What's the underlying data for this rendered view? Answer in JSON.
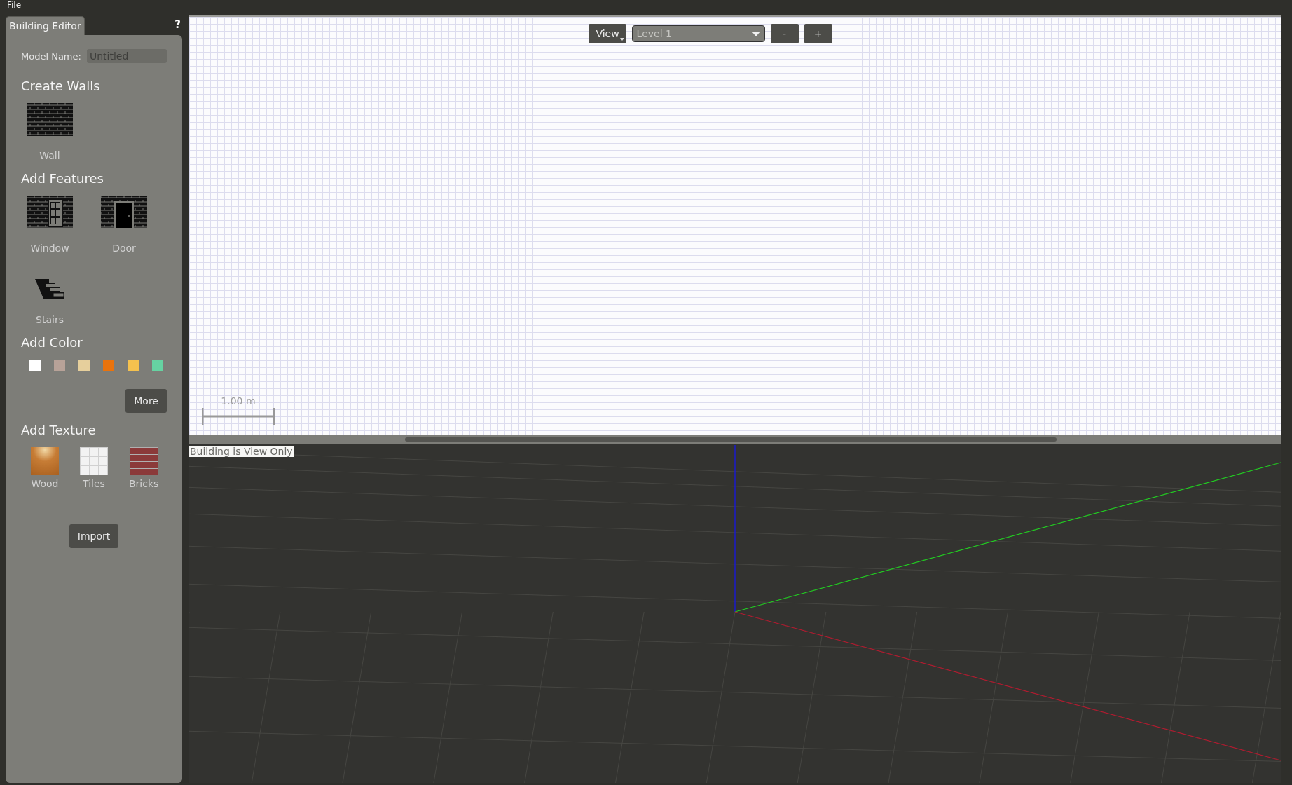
{
  "menu": [
    {
      "label": "File"
    }
  ],
  "sidebar": {
    "tab": {
      "label": "Building Editor",
      "selected": true
    },
    "help": "?",
    "model_name": {
      "label": "Model Name:",
      "placeholder": "Untitled"
    },
    "sections": [
      {
        "kind": "tools",
        "title": "Create Walls",
        "items": [
          {
            "kind": "wall",
            "label": "Wall"
          }
        ]
      },
      {
        "kind": "tools",
        "title": "Add Features",
        "items": [
          {
            "kind": "window",
            "label": "Window"
          },
          {
            "kind": "door",
            "label": "Door"
          },
          {
            "kind": "stairs",
            "label": "Stairs"
          }
        ]
      },
      {
        "kind": "colors",
        "title": "Add Color",
        "colors": [
          {
            "color": "#ffffff"
          },
          {
            "color": "#b8a298"
          },
          {
            "color": "#e6cf9c"
          },
          {
            "color": "#ea730c"
          },
          {
            "color": "#f5c14e"
          },
          {
            "color": "#66d3a2"
          }
        ],
        "button": "More"
      },
      {
        "kind": "textures",
        "title": "Add Texture",
        "items": [
          {
            "kind": "wood",
            "label": "Wood"
          },
          {
            "kind": "tiles",
            "label": "Tiles"
          },
          {
            "kind": "bricks",
            "label": "Bricks"
          }
        ],
        "button": "Import"
      }
    ]
  },
  "plan_view": {
    "view_button": "View",
    "level_select": "Level 1",
    "zoom_out": "-",
    "zoom_in": "+",
    "scale": "1.00 m"
  },
  "scene_view": {
    "status": "Building is View Only"
  }
}
